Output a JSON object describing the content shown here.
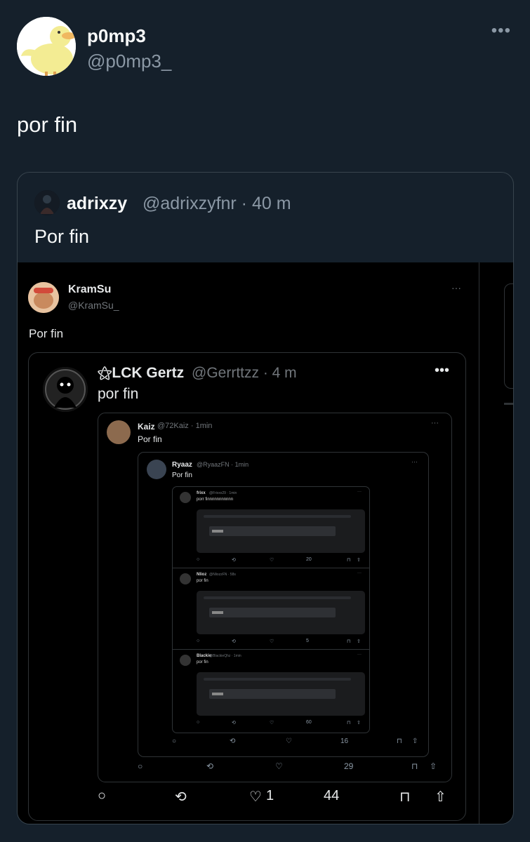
{
  "colors": {
    "background": "#15202b",
    "text": "#f7f9f9",
    "muted": "#8b98a5",
    "border": "#38444d"
  },
  "author": {
    "name": "p0mp3",
    "handle": "@p0mp3_",
    "more": "•••"
  },
  "tweet": {
    "text": "por fin"
  },
  "quote": {
    "name": "adrixzy",
    "handle": "@adrixzyfnr · 40 m",
    "text": "Por fin",
    "screenshot": {
      "kramsu": {
        "name": "KramSu",
        "handle": "@KramSu_",
        "more": "···",
        "text": "Por fin"
      },
      "gertz": {
        "name": "⚝LCK Gertz",
        "handle": "@Gerrttzz · 4 m",
        "more": "•••",
        "text": "por fin",
        "actions": {
          "reply": "○",
          "retweet": "⟲",
          "like": "♡",
          "like_count": "1",
          "views": "44",
          "bookmark": "⊓",
          "share": "⇧"
        }
      },
      "kaiz": {
        "name": "Kaiz",
        "handle": "@72Kaiz · 1min",
        "more": "···",
        "text": "Por fin",
        "actions": {
          "views": "29"
        }
      },
      "ryaaz": {
        "name": "Ryaaz",
        "handle": "@RyaazFN · 1min",
        "more": "···",
        "text": "Por fin",
        "actions": {
          "views": "16"
        }
      },
      "mini_posts": [
        {
          "name": "frixx",
          "handle": "@Frixxx29 · 1min",
          "text": "porr finnnnnnnnnnn",
          "more": "···",
          "views": "20"
        },
        {
          "name": "Nlioz",
          "handle": "@NliozzFN · 58s",
          "text": "por fin",
          "more": "···",
          "views": "5"
        },
        {
          "name": "Blackie",
          "handle": "@BlackieQhz · 1min",
          "text": "por fin",
          "more": "···",
          "views": "60"
        }
      ]
    }
  }
}
